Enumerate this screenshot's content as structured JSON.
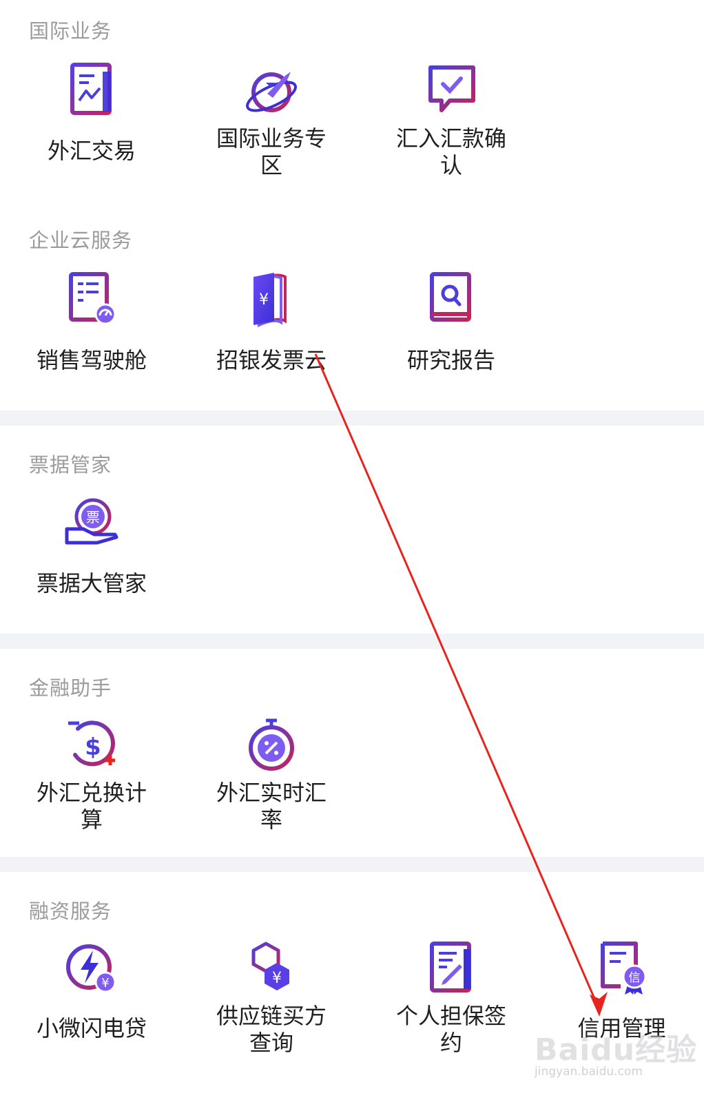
{
  "colors": {
    "accent": "#4b3fdc",
    "accent_pink": "#c5235a",
    "section_title": "#9b9b9b",
    "separator": "#f2f3f6",
    "arrow": "#e8231c"
  },
  "sections": [
    {
      "title": "国际业务",
      "items": [
        {
          "label": "外汇交易",
          "icon": "forex-chart-document-icon"
        },
        {
          "label": "国际业务专区",
          "icon": "globe-plane-icon"
        },
        {
          "label": "汇入汇款确认",
          "icon": "chat-check-icon"
        }
      ]
    },
    {
      "title": "企业云服务",
      "items": [
        {
          "label": "销售驾驶舱",
          "icon": "dashboard-document-icon"
        },
        {
          "label": "招银发票云",
          "icon": "invoice-book-yen-icon"
        },
        {
          "label": "研究报告",
          "icon": "research-book-search-icon"
        }
      ]
    },
    {
      "title": "票据管家",
      "items": [
        {
          "label": "票据大管家",
          "icon": "bill-hand-icon",
          "badge": "票"
        }
      ]
    },
    {
      "title": "金融助手",
      "items": [
        {
          "label": "外汇兑换计算",
          "icon": "dollar-timer-plus-icon"
        },
        {
          "label": "外汇实时汇率",
          "icon": "stopwatch-percent-icon"
        }
      ]
    },
    {
      "title": "融资服务",
      "items": [
        {
          "label": "小微闪电贷",
          "icon": "lightning-yen-icon"
        },
        {
          "label": "供应链买方查询",
          "icon": "hexagon-yen-icon"
        },
        {
          "label": "个人担保签约",
          "icon": "sign-document-icon"
        },
        {
          "label": "信用管理",
          "icon": "credit-certificate-icon",
          "badge": "信"
        }
      ]
    }
  ],
  "watermark": {
    "logo": "Baidu经验",
    "url": "jingyan.baidu.com"
  }
}
